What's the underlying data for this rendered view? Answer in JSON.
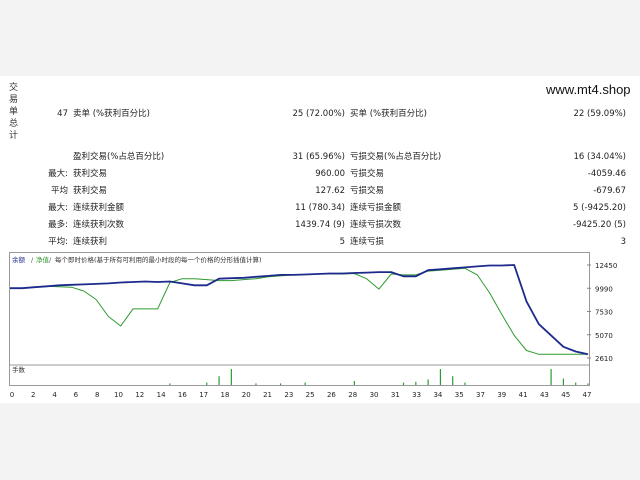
{
  "brand": "www.mt4.shop",
  "side_label": [
    "交",
    "易",
    "单",
    "总",
    "计"
  ],
  "stats": {
    "total_trades": "47",
    "short_label": "卖单 (%获利百分比)",
    "short_value": "25 (72.00%)",
    "long_label": "买单 (%获利百分比)",
    "long_value": "22 (59.09%)",
    "profit_trades_label": "盈利交易(%占总百分比)",
    "profit_trades_value": "31 (65.96%)",
    "loss_trades_label": "亏损交易(%占总百分比)",
    "loss_trades_value": "16 (34.04%)",
    "largest_prefix": "最大:",
    "largest_profit_label": "获利交易",
    "largest_profit_value": "960.00",
    "largest_loss_label": "亏损交易",
    "largest_loss_value": "-4059.46",
    "average_prefix": "平均",
    "avg_profit_label": "获利交易",
    "avg_profit_value": "127.62",
    "avg_loss_label": "亏损交易",
    "avg_loss_value": "-679.67",
    "max_prefix": "最大:",
    "max_consec_wins_label": "连续获利金额",
    "max_consec_wins_value": "11 (780.34)",
    "max_consec_losses_label": "连续亏损金额",
    "max_consec_losses_value": "5 (-9425.20)",
    "maximal_prefix": "最多:",
    "maximal_consec_profit_label": "连续获利次数",
    "maximal_consec_profit_value": "1439.74 (9)",
    "maximal_consec_loss_label": "连续亏损次数",
    "maximal_consec_loss_value": "-9425.20 (5)",
    "average2_prefix": "平均:",
    "avg_consec_wins_label": "连续获利",
    "avg_consec_wins_value": "5",
    "avg_consec_losses_label": "连续亏损",
    "avg_consec_losses_value": "3"
  },
  "chart_data": {
    "type": "line",
    "legend": [
      "余额",
      "净值",
      "每个即时价格(基于所有可利用的最小时段的每一个价格的分形插值计算)"
    ],
    "volume_label": "手数",
    "y_ticks": [
      "12450",
      "9990",
      "7530",
      "5070",
      "2610"
    ],
    "ylim": [
      2610,
      12450
    ],
    "x_ticks": [
      "0",
      "2",
      "4",
      "6",
      "8",
      "10",
      "12",
      "14",
      "16",
      "17",
      "18",
      "20",
      "21",
      "23",
      "25",
      "26",
      "28",
      "30",
      "31",
      "33",
      "34",
      "35",
      "37",
      "39",
      "41",
      "43",
      "45",
      "47"
    ],
    "colors": {
      "balance": "#1c2a8c",
      "equity": "#2e9a2e",
      "axis": "#888888"
    },
    "x": [
      0,
      1,
      2,
      3,
      4,
      5,
      6,
      7,
      8,
      9,
      10,
      11,
      12,
      13,
      14,
      15,
      16,
      17,
      18,
      19,
      20,
      21,
      22,
      23,
      24,
      25,
      26,
      27,
      28,
      29,
      30,
      31,
      32,
      33,
      34,
      35,
      36,
      37,
      38,
      39,
      40,
      41,
      42,
      43,
      44,
      45,
      46,
      47
    ],
    "series": [
      {
        "values": [
          10000,
          10000,
          10100,
          10200,
          10300,
          10350,
          10400,
          10450,
          10500,
          10600,
          10650,
          10700,
          10650,
          10700,
          10500,
          10300,
          10300,
          11000,
          11050,
          11100,
          11200,
          11300,
          11400,
          11400,
          11450,
          11500,
          11550,
          11550,
          11600,
          11650,
          11700,
          11700,
          11250,
          11250,
          11900,
          12000,
          12100,
          12200,
          12300,
          12400,
          12400,
          12450,
          8600,
          6200,
          5000,
          3800,
          3300,
          3000
        ]
      },
      {
        "values": [
          10000,
          10000,
          10100,
          10200,
          10150,
          10100,
          9700,
          8800,
          7000,
          6000,
          7800,
          7800,
          7800,
          10600,
          11000,
          11000,
          10900,
          10800,
          10800,
          10900,
          11000,
          11200,
          11300,
          11400,
          11450,
          11500,
          11500,
          11500,
          11550,
          11000,
          9900,
          11500,
          11400,
          11400,
          11800,
          11900,
          12000,
          12100,
          11400,
          9500,
          7200,
          5000,
          3400,
          3000,
          3000,
          3000,
          3000,
          3000
        ]
      }
    ],
    "volumes": [
      0,
      0,
      0,
      0,
      0,
      0,
      0,
      0,
      0,
      0,
      0,
      0,
      0,
      0.1,
      0,
      0,
      0.15,
      0.55,
      1.0,
      0,
      0.1,
      0,
      0.1,
      0,
      0.15,
      0,
      0,
      0,
      0.25,
      0,
      0,
      0,
      0.15,
      0.2,
      0.35,
      1.0,
      0.55,
      0.15,
      0,
      0,
      0,
      0,
      0,
      0,
      1.0,
      0.4,
      0.15,
      0.1
    ]
  }
}
